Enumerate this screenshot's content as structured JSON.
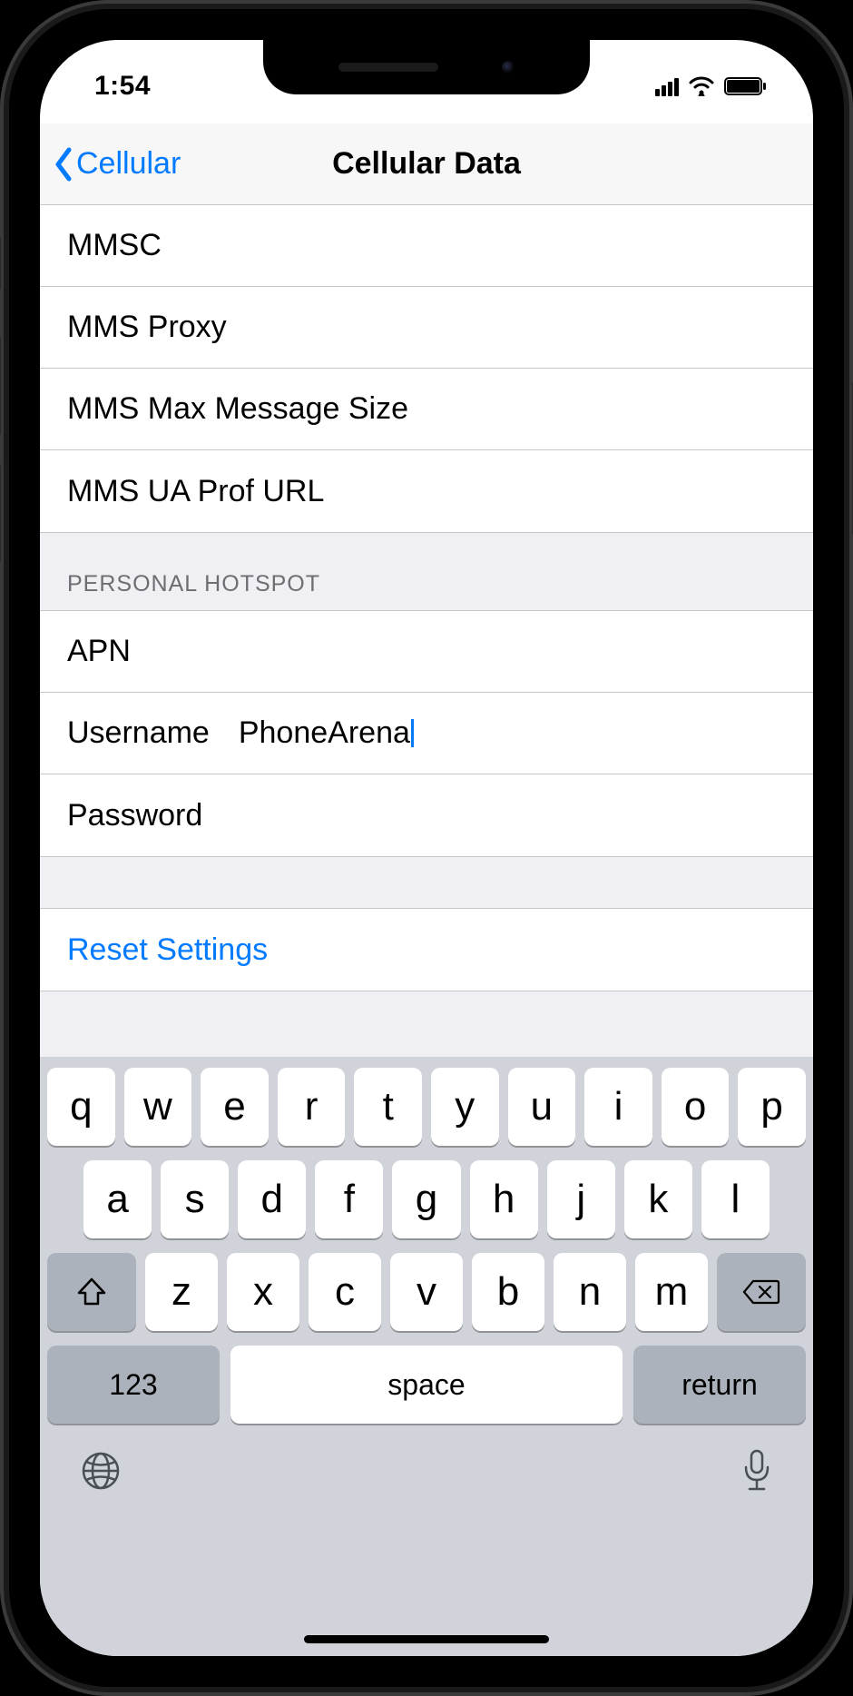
{
  "status": {
    "time": "1:54"
  },
  "nav": {
    "back_label": "Cellular",
    "title": "Cellular Data"
  },
  "mms_section": {
    "rows": [
      {
        "label": "MMSC"
      },
      {
        "label": "MMS Proxy"
      },
      {
        "label": "MMS Max Message Size"
      },
      {
        "label": "MMS UA Prof URL"
      }
    ]
  },
  "hotspot_section": {
    "header": "PERSONAL HOTSPOT",
    "apn_label": "APN",
    "username_label": "Username",
    "username_value": "PhoneArena",
    "password_label": "Password"
  },
  "actions": {
    "reset_label": "Reset Settings"
  },
  "keyboard": {
    "row1": [
      "q",
      "w",
      "e",
      "r",
      "t",
      "y",
      "u",
      "i",
      "o",
      "p"
    ],
    "row2": [
      "a",
      "s",
      "d",
      "f",
      "g",
      "h",
      "j",
      "k",
      "l"
    ],
    "row3": [
      "z",
      "x",
      "c",
      "v",
      "b",
      "n",
      "m"
    ],
    "numbers_label": "123",
    "space_label": "space",
    "return_label": "return"
  }
}
